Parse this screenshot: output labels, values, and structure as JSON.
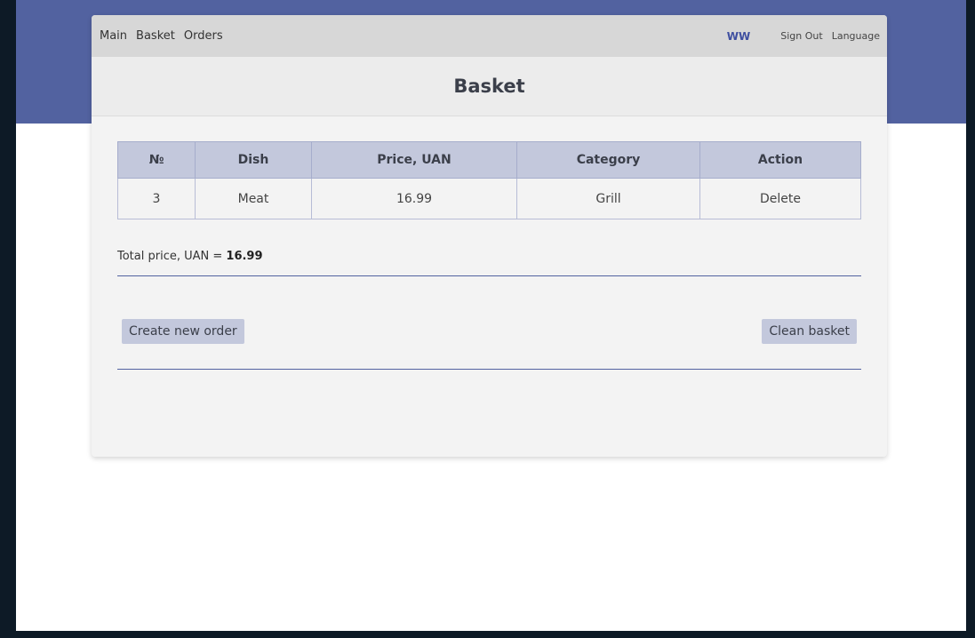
{
  "nav": {
    "links": [
      "Main",
      "Basket",
      "Orders"
    ],
    "user": "WW",
    "sign_out": "Sign Out",
    "language": "Language"
  },
  "page": {
    "title": "Basket"
  },
  "table": {
    "headers": [
      "№",
      "Dish",
      "Price, UAN",
      "Category",
      "Action"
    ],
    "rows": [
      [
        "3",
        "Meat",
        "16.99",
        "Grill",
        "Delete"
      ]
    ]
  },
  "total": {
    "label": "Total price, UAN = ",
    "value": "16.99"
  },
  "actions": {
    "create_order": "Create new order",
    "clean_basket": "Clean basket"
  },
  "colors": {
    "accent": "#5262a0",
    "table_header": "#c3c8dc",
    "card_bg": "#f3f3f3"
  }
}
